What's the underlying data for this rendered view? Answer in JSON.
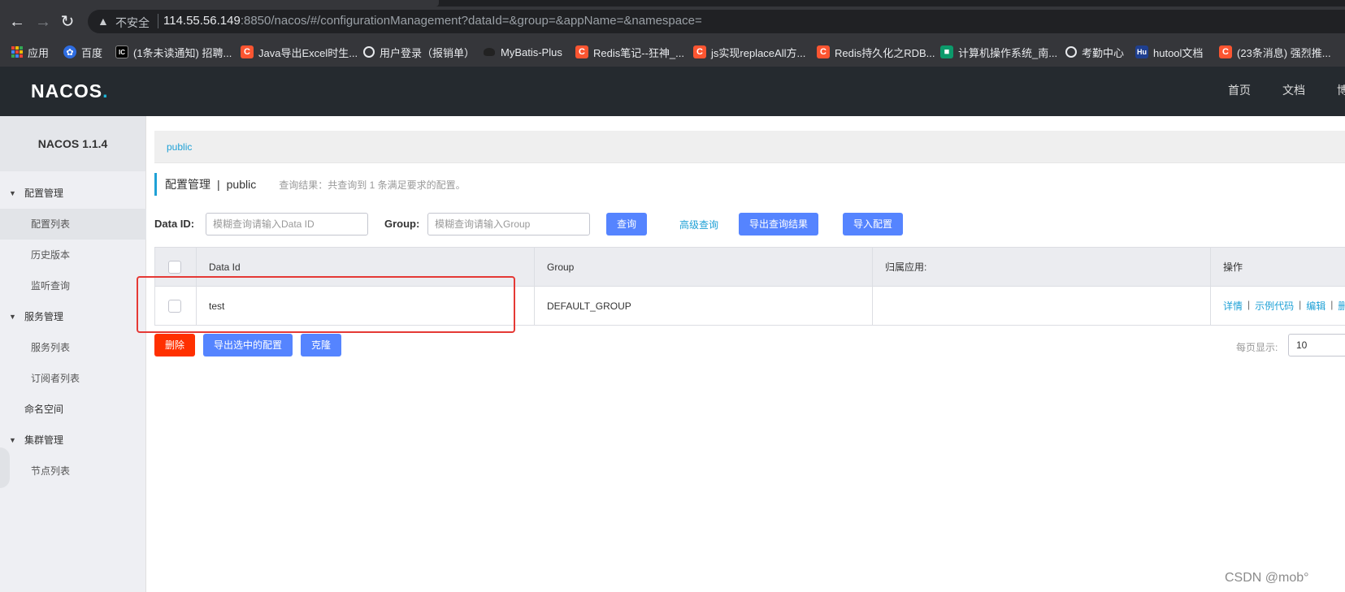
{
  "browser": {
    "insecure_label": "不安全",
    "url_host": "114.55.56.149",
    "url_rest": ":8850/nacos/#/configurationManagement?dataId=&group=&appName=&namespace=",
    "bookmarks": [
      {
        "label": "应用",
        "icon": "apps-icon"
      },
      {
        "label": "百度",
        "icon": "baidu-icon"
      },
      {
        "label": "(1条未读通知) 招聘...",
        "icon": "dark-icon"
      },
      {
        "label": "Java导出Excel时生...",
        "icon": "csdn-icon"
      },
      {
        "label": "用户登录（报销单）",
        "icon": "globe-icon"
      },
      {
        "label": "MyBatis-Plus",
        "icon": "mybatis-icon"
      },
      {
        "label": "Redis笔记--狂神_...",
        "icon": "csdn-icon"
      },
      {
        "label": "js实现replaceAll方...",
        "icon": "csdn-icon"
      },
      {
        "label": "Redis持久化之RDB...",
        "icon": "csdn-icon"
      },
      {
        "label": "计算机操作系统_南...",
        "icon": "green-icon"
      },
      {
        "label": "考勤中心",
        "icon": "globe-icon"
      },
      {
        "label": "hutool文档",
        "icon": "hutool-icon"
      },
      {
        "label": "(23条消息) 强烈推...",
        "icon": "csdn-icon"
      }
    ]
  },
  "header": {
    "logo_main": "NACOS",
    "logo_dot": ".",
    "links": [
      "首页",
      "文档",
      "博"
    ]
  },
  "sidebar": {
    "version": "NACOS 1.1.4",
    "items": [
      {
        "label": "配置管理",
        "type": "group"
      },
      {
        "label": "配置列表",
        "type": "child",
        "selected": true
      },
      {
        "label": "历史版本",
        "type": "child"
      },
      {
        "label": "监听查询",
        "type": "child"
      },
      {
        "label": "服务管理",
        "type": "group"
      },
      {
        "label": "服务列表",
        "type": "child"
      },
      {
        "label": "订阅者列表",
        "type": "child"
      },
      {
        "label": "命名空间",
        "type": "plain"
      },
      {
        "label": "集群管理",
        "type": "group"
      },
      {
        "label": "节点列表",
        "type": "child"
      }
    ]
  },
  "main": {
    "namespace_tab": "public",
    "title": "配置管理",
    "title_sep": "|",
    "title_ns": "public",
    "result_text": "查询结果：共查询到 1 条满足要求的配置。",
    "filters": {
      "dataid_label": "Data ID:",
      "dataid_placeholder": "模糊查询请输入Data ID",
      "group_label": "Group:",
      "group_placeholder": "模糊查询请输入Group"
    },
    "buttons": {
      "query": "查询",
      "advanced": "高级查询",
      "export_results": "导出查询结果",
      "import": "导入配置",
      "delete": "删除",
      "export_selected": "导出选中的配置",
      "clone": "克隆"
    },
    "table": {
      "headers": [
        "Data Id",
        "Group",
        "归属应用:",
        "操作"
      ],
      "rows": [
        {
          "data_id": "test",
          "group": "DEFAULT_GROUP",
          "app": "",
          "ops": [
            "详情",
            "示例代码",
            "编辑",
            "删"
          ]
        }
      ]
    },
    "page_size_label": "每页显示:",
    "page_size": "10"
  },
  "watermark": "CSDN @mob°",
  "colors": {
    "accent": "#1fa1d6",
    "primary_button": "#5584ff",
    "danger_button": "#ff3000",
    "header_bg": "#252a2f",
    "highlight": "#e53935"
  }
}
